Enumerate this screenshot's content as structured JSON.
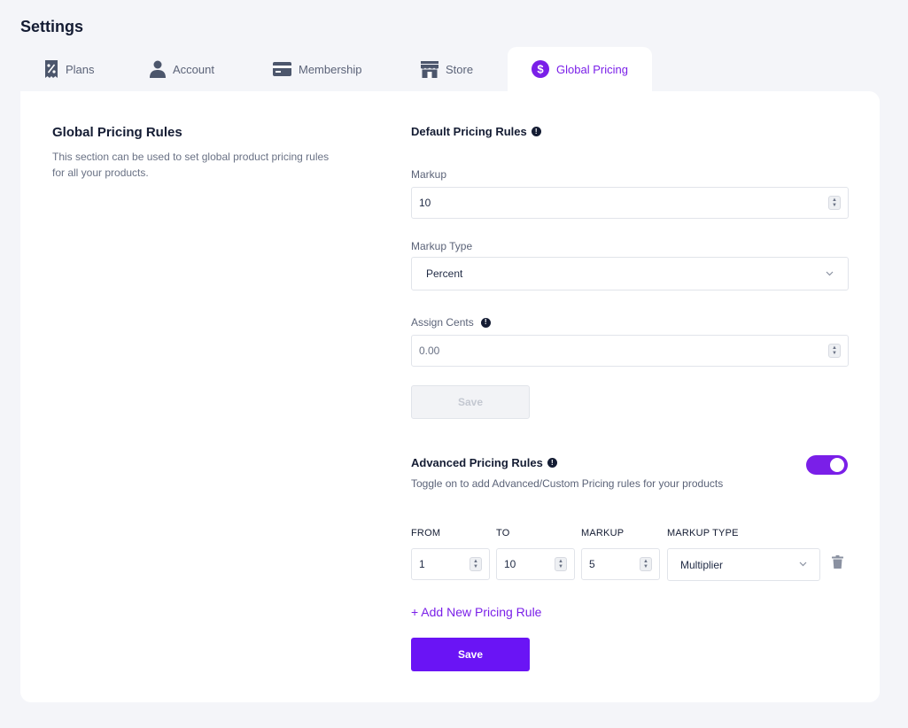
{
  "page": {
    "title": "Settings"
  },
  "tabs": [
    {
      "label": "Plans",
      "icon": "receipt-percent-icon",
      "active": false
    },
    {
      "label": "Account",
      "icon": "user-icon",
      "active": false
    },
    {
      "label": "Membership",
      "icon": "credit-card-icon",
      "active": false
    },
    {
      "label": "Store",
      "icon": "store-icon",
      "active": false
    },
    {
      "label": "Global Pricing",
      "icon": "dollar-circle-icon",
      "active": true
    }
  ],
  "left": {
    "title": "Global Pricing Rules",
    "description": "This section can be used to set global product pricing rules for all your products."
  },
  "default_rules": {
    "title": "Default Pricing Rules",
    "info_glyph": "!",
    "markup": {
      "label": "Markup",
      "value": "10"
    },
    "markup_type": {
      "label": "Markup Type",
      "value": "Percent"
    },
    "assign_cents": {
      "label": "Assign Cents",
      "placeholder": "0.00"
    },
    "save_label": "Save"
  },
  "advanced_rules": {
    "title": "Advanced Pricing Rules",
    "description": "Toggle on to add Advanced/Custom Pricing rules for your products",
    "enabled": true,
    "columns": [
      "FROM",
      "TO",
      "MARKUP",
      "MARKUP TYPE"
    ],
    "rows": [
      {
        "from": "1",
        "to": "10",
        "markup": "5",
        "markup_type": "Multiplier"
      }
    ],
    "add_label": "+ Add New Pricing Rule",
    "save_label": "Save"
  },
  "colors": {
    "accent": "#7a1fe8",
    "primary_button": "#6a14f5",
    "background": "#f4f5f9",
    "card": "#ffffff",
    "text_dark": "#141c33"
  }
}
